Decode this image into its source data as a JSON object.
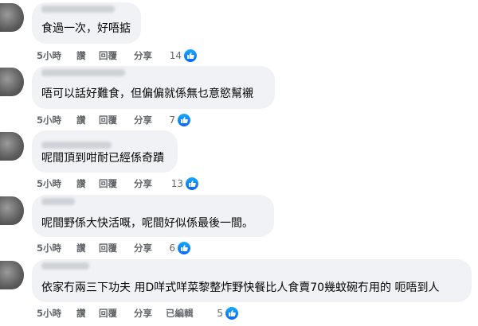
{
  "colors": {
    "bubble": "#f0f2f5",
    "meta": "#65676b",
    "like": "#0866ff"
  },
  "comments": [
    {
      "text": "食過一次，好唔掂",
      "time": "5小時",
      "like_label": "讚",
      "reply_label": "回覆",
      "share_label": "分享",
      "reactions": "14",
      "reaction_icon": "thumbs-up-icon"
    },
    {
      "text": "唔可以話好難食，但偏偏就係無乜意慾幫襯",
      "time": "5小時",
      "like_label": "讚",
      "reply_label": "回覆",
      "share_label": "分享",
      "reactions": "7",
      "reaction_icon": "thumbs-up-icon"
    },
    {
      "text": "呢間頂到咁耐已經係奇蹟",
      "time": "5小時",
      "like_label": "讚",
      "reply_label": "回覆",
      "share_label": "分享",
      "reactions": "13",
      "reaction_icon": "thumbs-up-icon"
    },
    {
      "text": "呢間野係大快活嘅，呢間好似係最後一間。",
      "time": "5小時",
      "like_label": "讚",
      "reply_label": "回覆",
      "share_label": "分享",
      "reactions": "6",
      "reaction_icon": "thumbs-up-icon"
    },
    {
      "text": "依家冇兩三下功夫 用D咩式咩菜黎整炸野快餐比人食賣70幾蚊碗冇用的 呃唔到人",
      "time": "5小時",
      "like_label": "讚",
      "reply_label": "回覆",
      "share_label": "分享",
      "edited_label": "已編輯",
      "reactions": "5",
      "reaction_icon": "thumbs-up-icon"
    }
  ]
}
